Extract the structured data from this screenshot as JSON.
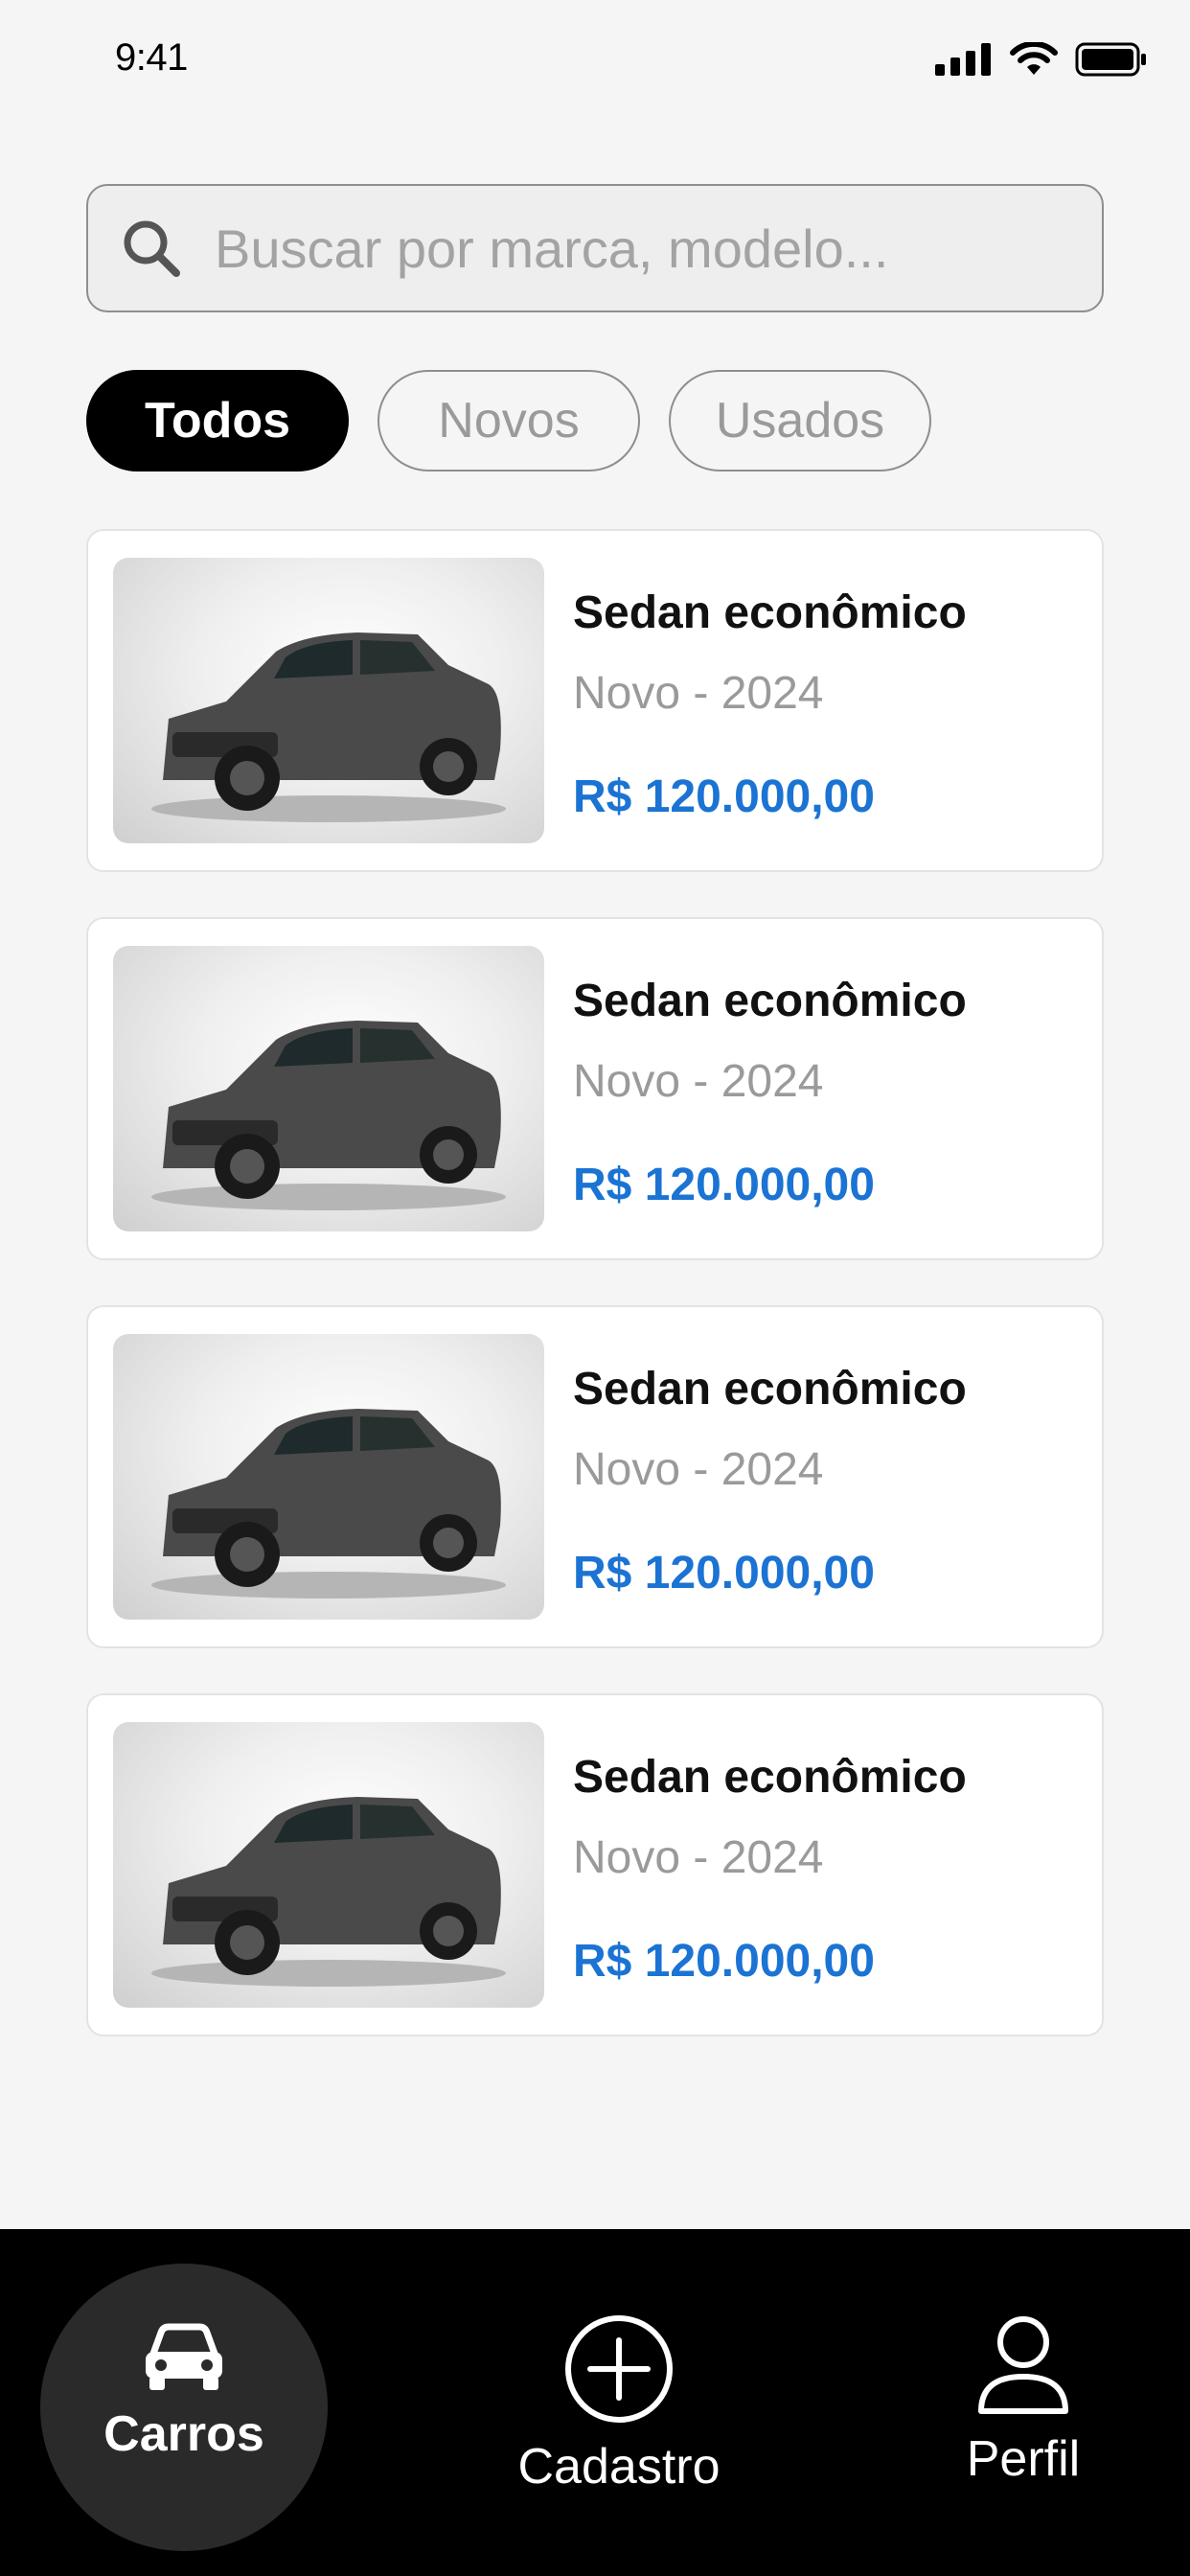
{
  "status_bar": {
    "time": "9:41"
  },
  "search": {
    "placeholder": "Buscar por marca, modelo..."
  },
  "filters": [
    {
      "label": "Todos",
      "active": true
    },
    {
      "label": "Novos",
      "active": false
    },
    {
      "label": "Usados",
      "active": false
    }
  ],
  "cars": [
    {
      "title": "Sedan econômico",
      "subtitle": "Novo - 2024",
      "price": "R$ 120.000,00"
    },
    {
      "title": "Sedan econômico",
      "subtitle": "Novo - 2024",
      "price": "R$ 120.000,00"
    },
    {
      "title": "Sedan econômico",
      "subtitle": "Novo - 2024",
      "price": "R$ 120.000,00"
    },
    {
      "title": "Sedan econômico",
      "subtitle": "Novo - 2024",
      "price": "R$ 120.000,00"
    }
  ],
  "bottom_nav": {
    "items": [
      {
        "label": "Carros",
        "icon": "car-icon",
        "active": true
      },
      {
        "label": "Cadastro",
        "icon": "plus-circle-icon",
        "active": false
      },
      {
        "label": "Perfil",
        "icon": "user-icon",
        "active": false
      }
    ]
  },
  "colors": {
    "accent_price": "#1b73d3",
    "chip_active_bg": "#000000",
    "nav_bg": "#000000",
    "background": "#f5f5f5"
  }
}
